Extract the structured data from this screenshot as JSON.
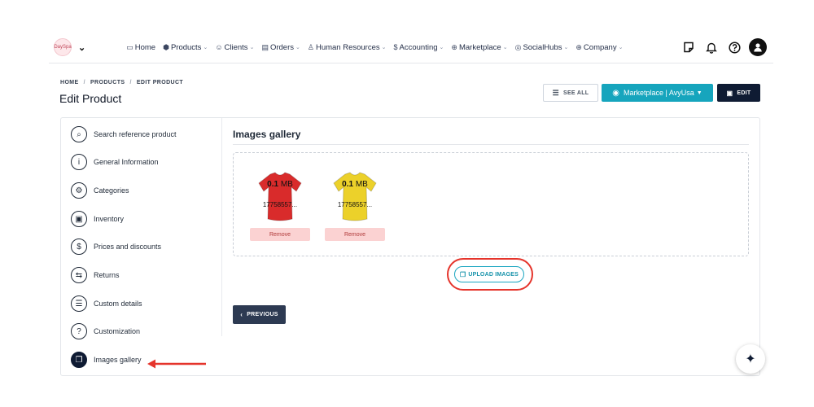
{
  "nav": {
    "logo_text": "DaySpa",
    "items": [
      {
        "label": "Home",
        "icon": "monitor-icon",
        "glyph": "▭",
        "has_caret": false
      },
      {
        "label": "Products",
        "icon": "cube-icon",
        "glyph": "⬢",
        "has_caret": true
      },
      {
        "label": "Clients",
        "icon": "users-icon",
        "glyph": "☺",
        "has_caret": true
      },
      {
        "label": "Orders",
        "icon": "clipboard-icon",
        "glyph": "▤",
        "has_caret": true
      },
      {
        "label": "Human Resources",
        "icon": "user-plus-icon",
        "glyph": "♙",
        "has_caret": true
      },
      {
        "label": "Accounting",
        "icon": "dollar-icon",
        "glyph": "$",
        "has_caret": true
      },
      {
        "label": "Marketplace",
        "icon": "globe-icon",
        "glyph": "⊕",
        "has_caret": true
      },
      {
        "label": "SocialHubs",
        "icon": "hub-icon",
        "glyph": "◎",
        "has_caret": true
      },
      {
        "label": "Company",
        "icon": "globe-icon",
        "glyph": "⊕",
        "has_caret": true
      }
    ]
  },
  "header": {
    "breadcrumb": [
      "HOME",
      "PRODUCTS",
      "EDIT PRODUCT"
    ],
    "title": "Edit Product",
    "see_all": "SEE ALL",
    "marketplace": "Marketplace | AvyUsa",
    "edit": "EDIT"
  },
  "sidebar": {
    "items": [
      {
        "label": "Search reference product",
        "icon": "search-icon",
        "glyph": "⌕",
        "active": false
      },
      {
        "label": "General Information",
        "icon": "info-icon",
        "glyph": "i",
        "active": false
      },
      {
        "label": "Categories",
        "icon": "gear-icon",
        "glyph": "⚙",
        "active": false
      },
      {
        "label": "Inventory",
        "icon": "box-icon",
        "glyph": "▣",
        "active": false
      },
      {
        "label": "Prices and discounts",
        "icon": "dollar-icon",
        "glyph": "$",
        "active": false
      },
      {
        "label": "Returns",
        "icon": "return-icon",
        "glyph": "⇆",
        "active": false
      },
      {
        "label": "Custom details",
        "icon": "list-icon",
        "glyph": "☰",
        "active": false
      },
      {
        "label": "Customization",
        "icon": "question-icon",
        "glyph": "?",
        "active": false
      },
      {
        "label": "Images gallery",
        "icon": "images-icon",
        "glyph": "❐",
        "active": true
      }
    ]
  },
  "gallery": {
    "title": "Images gallery",
    "images": [
      {
        "size_value": "0.1",
        "size_unit": "MB",
        "filename": "17758557...",
        "remove": "Remove",
        "color": "#d92b2b"
      },
      {
        "size_value": "0.1",
        "size_unit": "MB",
        "filename": "17758557...",
        "remove": "Remove",
        "color": "#ecd12a"
      }
    ],
    "upload_label": "UPLOAD IMAGES",
    "previous_label": "PREVIOUS"
  },
  "colors": {
    "accent": "#16a5bd",
    "dark": "#0f1b33",
    "highlight": "#e5342b"
  }
}
